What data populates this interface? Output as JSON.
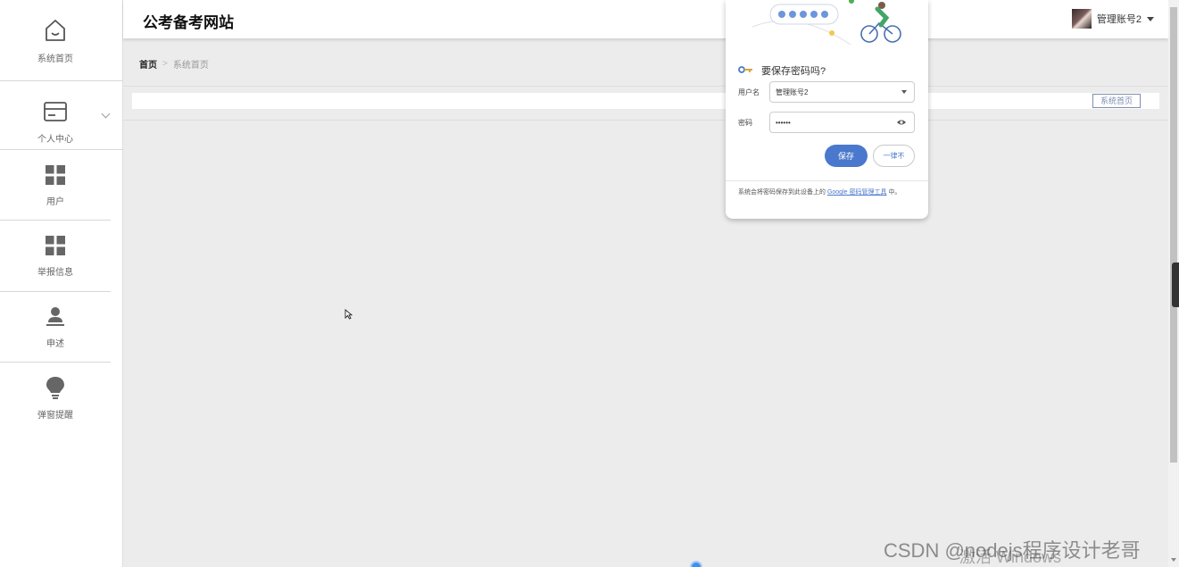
{
  "sidebar": {
    "items": [
      {
        "label": "系统首页",
        "icon": "home-icon"
      },
      {
        "label": "个人中心",
        "icon": "card-icon"
      },
      {
        "label": "用户",
        "icon": "grid-icon"
      },
      {
        "label": "举报信息",
        "icon": "grid-icon"
      },
      {
        "label": "申述",
        "icon": "user-stamp-icon"
      },
      {
        "label": "弹窗提醒",
        "icon": "bulb-icon"
      }
    ]
  },
  "header": {
    "title": "公考备考网站",
    "user_name": "管理账号2"
  },
  "breadcrumb": {
    "home": "首页",
    "separator": ">",
    "current": "系统首页"
  },
  "tabs": [
    {
      "label": "系统首页"
    }
  ],
  "password_popup": {
    "title": "要保存密码吗?",
    "username_label": "用户名",
    "username_value": "管理账号2",
    "password_label": "密码",
    "password_value": "••••••",
    "save_label": "保存",
    "never_label": "一律不",
    "note_prefix": "系统会将密码保存到此设备上的",
    "note_link": "Google 密码管理工具",
    "note_suffix": "中。"
  },
  "watermarks": {
    "windows": "激活 Windows",
    "csdn": "CSDN @nodejs程序设计老哥"
  },
  "colors": {
    "accent_blue": "#4a78cc",
    "tab_border": "#7d8fb0",
    "sidebar_bg": "#ffffff",
    "content_bg": "#ececec"
  }
}
